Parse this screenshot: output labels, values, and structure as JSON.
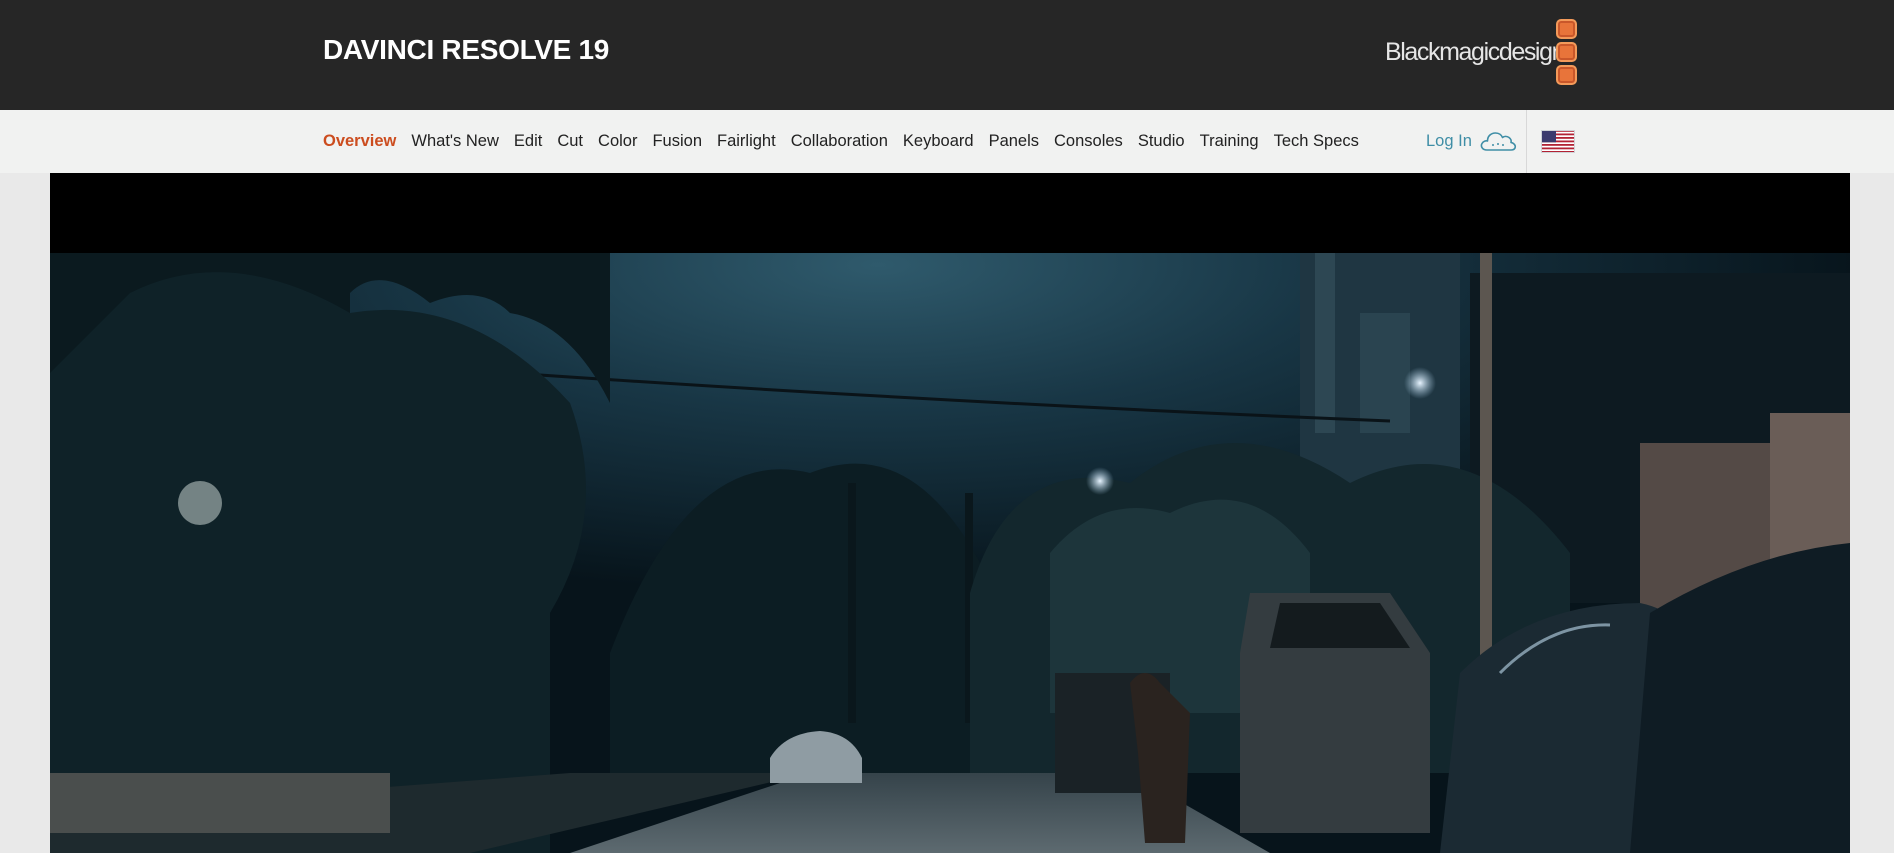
{
  "header": {
    "product_title": "DAVINCI RESOLVE 19",
    "brand_text": "Blackmagicdesign",
    "brand_logo_color": "#e8743a"
  },
  "nav": {
    "items": [
      {
        "label": "Overview",
        "active": true
      },
      {
        "label": "What's New",
        "active": false
      },
      {
        "label": "Edit",
        "active": false
      },
      {
        "label": "Cut",
        "active": false
      },
      {
        "label": "Color",
        "active": false
      },
      {
        "label": "Fusion",
        "active": false
      },
      {
        "label": "Fairlight",
        "active": false
      },
      {
        "label": "Collaboration",
        "active": false
      },
      {
        "label": "Keyboard",
        "active": false
      },
      {
        "label": "Panels",
        "active": false
      },
      {
        "label": "Consoles",
        "active": false
      },
      {
        "label": "Studio",
        "active": false
      },
      {
        "label": "Training",
        "active": false
      },
      {
        "label": "Tech Specs",
        "active": false
      }
    ],
    "login_label": "Log In",
    "login_icon": "cloud-icon",
    "region_icon": "us-flag-icon"
  },
  "colors": {
    "header_bg": "#262626",
    "nav_bg": "#f1f2f1",
    "active_nav": "#cc4d1f",
    "login_link": "#3f8ea6"
  },
  "hero": {
    "media": "night-street-scene",
    "letterbox": "black"
  }
}
